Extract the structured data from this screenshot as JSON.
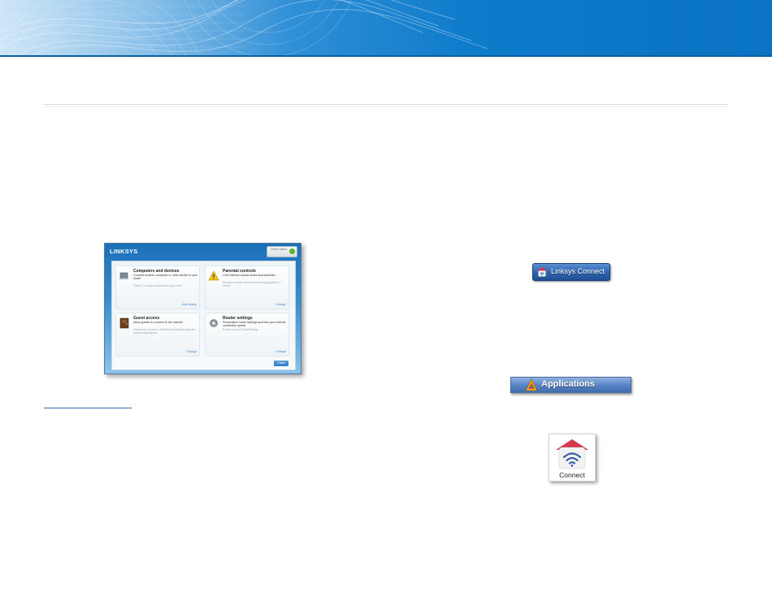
{
  "colors": {
    "banner_blue": "#0a73c3",
    "rule_gray": "#d6d6d6",
    "link_blue": "#2f6fb5",
    "connect_red": "#d8364a"
  },
  "dashboard": {
    "logo": "LINKSYS",
    "status": "Online status",
    "tiles": [
      {
        "title": "Computers and devices",
        "description": "Connect another computer or other device to your router.",
        "status": "There is 1 device connected to your router.",
        "action": "Add device",
        "icon": "computer-icon"
      },
      {
        "title": "Parental controls",
        "description": "Limit Internet access times and websites.",
        "status": "Parental controls restrictions are being applied to 1 device.",
        "action": "Change",
        "icon": "warning-icon"
      },
      {
        "title": "Guest access",
        "description": "Allow guests to connect to the Internet",
        "status": "Guests can connect to BrownGuest network using the password guestpass.",
        "action": "Change",
        "icon": "door-icon"
      },
      {
        "title": "Router settings",
        "description": "Personalize router settings and test your Internet connection speed.",
        "status": "Router name is RouterSettings",
        "action": "Change",
        "icon": "gear-icon"
      }
    ],
    "close": "Close"
  },
  "linksys_connect_button": {
    "label": "Linksys Connect",
    "icon": "connect-house-icon"
  },
  "applications_bar": {
    "label": "Applications",
    "icon": "applications-folder-icon"
  },
  "connect_app": {
    "label": "Connect",
    "icon": "connect-house-wifi-icon"
  }
}
